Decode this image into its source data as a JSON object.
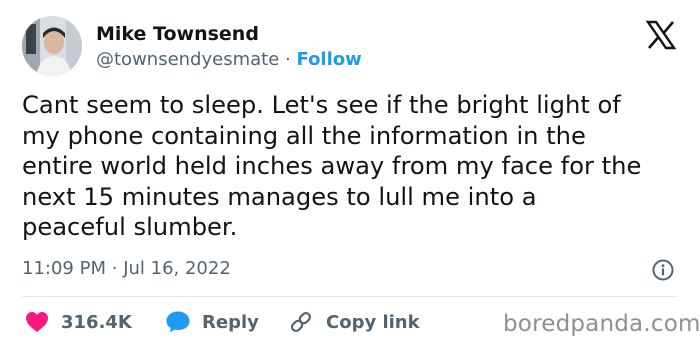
{
  "user": {
    "name": "Mike Townsend",
    "handle": "@townsendyesmate",
    "separator": "·",
    "follow_label": "Follow"
  },
  "tweet": {
    "text": "Cant seem to sleep. Let's see if the bright light of\nmy phone containing all the information in the\nentire world held inches away from my face for the\nnext 15 minutes manages to lull me into a\npeaceful slumber.",
    "time": "11:09 PM",
    "meta_separator": "·",
    "date": "Jul 16, 2022"
  },
  "actions": {
    "like_count": "316.4K",
    "reply_label": "Reply",
    "copy_label": "Copy link"
  },
  "watermark": "boredpanda.com",
  "icons": {
    "logo": "x-logo-icon",
    "info": "info-icon",
    "like": "heart-icon",
    "reply": "reply-bubble-icon",
    "copy": "link-icon"
  },
  "colors": {
    "text": "#0f1419",
    "secondary": "#536471",
    "follow": "#1d9bf0",
    "heart": "#f91880",
    "reply_bubble": "#1d9bf0",
    "watermark": "#8f8f8f"
  }
}
